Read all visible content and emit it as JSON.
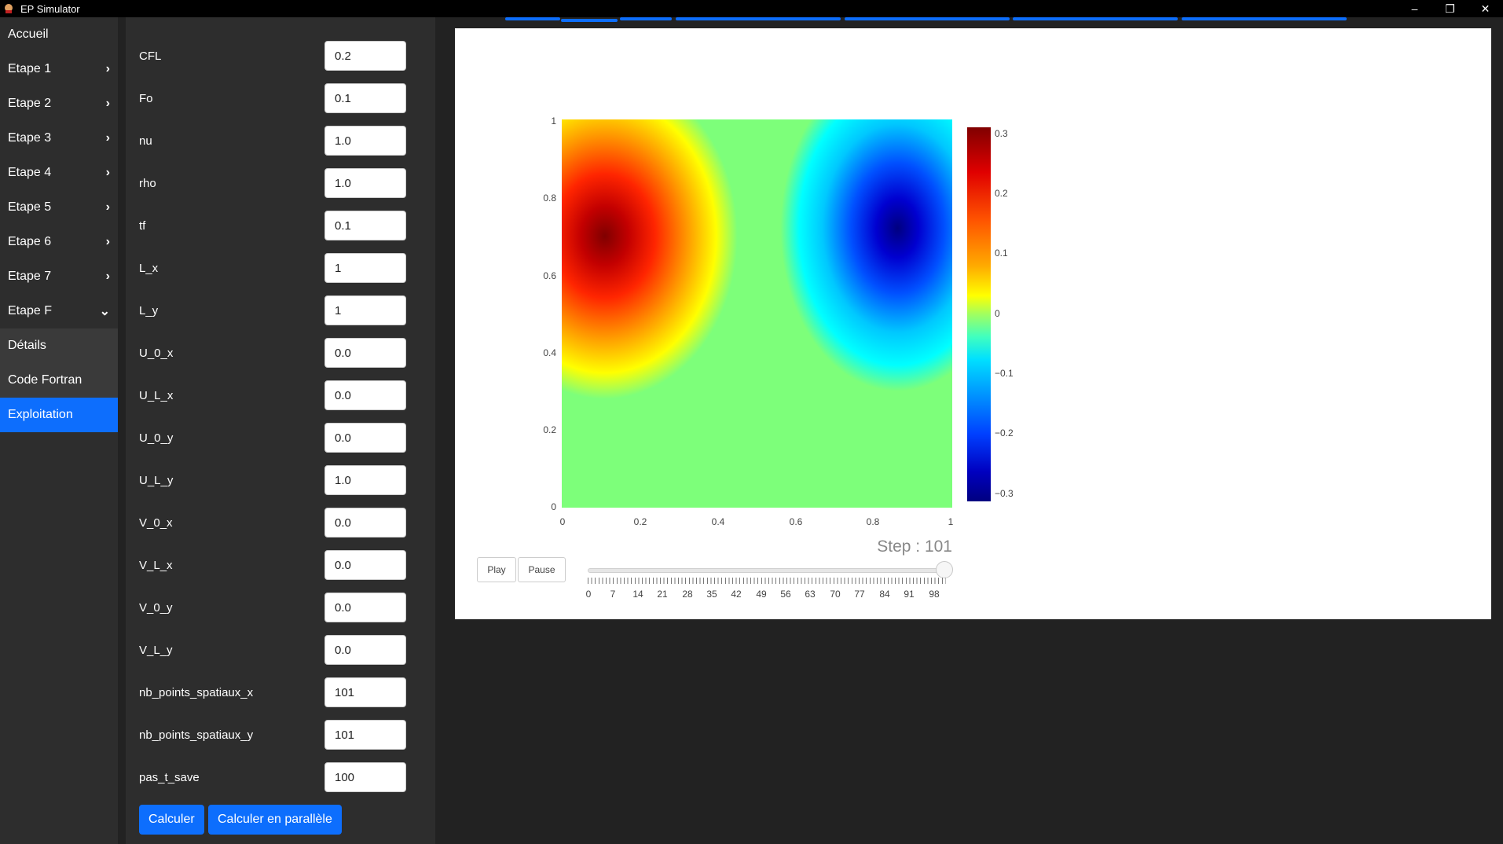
{
  "window": {
    "title": "EP Simulator",
    "minimize": "–",
    "restore": "❐",
    "close": "✕"
  },
  "sidebar": {
    "items": [
      {
        "label": "Accueil",
        "chevron": ""
      },
      {
        "label": "Etape 1",
        "chevron": "›"
      },
      {
        "label": "Etape 2",
        "chevron": "›"
      },
      {
        "label": "Etape 3",
        "chevron": "›"
      },
      {
        "label": "Etape 4",
        "chevron": "›"
      },
      {
        "label": "Etape 5",
        "chevron": "›"
      },
      {
        "label": "Etape 6",
        "chevron": "›"
      },
      {
        "label": "Etape 7",
        "chevron": "›"
      },
      {
        "label": "Etape F",
        "chevron": "⌄"
      },
      {
        "label": "Détails",
        "chevron": ""
      },
      {
        "label": "Code Fortran",
        "chevron": ""
      },
      {
        "label": "Exploitation",
        "chevron": ""
      }
    ]
  },
  "params": [
    {
      "label": "CFL",
      "value": "0.2"
    },
    {
      "label": "Fo",
      "value": "0.1"
    },
    {
      "label": "nu",
      "value": "1.0"
    },
    {
      "label": "rho",
      "value": "1.0"
    },
    {
      "label": "tf",
      "value": "0.1"
    },
    {
      "label": "L_x",
      "value": "1"
    },
    {
      "label": "L_y",
      "value": "1"
    },
    {
      "label": "U_0_x",
      "value": "0.0"
    },
    {
      "label": "U_L_x",
      "value": "0.0"
    },
    {
      "label": "U_0_y",
      "value": "0.0"
    },
    {
      "label": "U_L_y",
      "value": "1.0"
    },
    {
      "label": "V_0_x",
      "value": "0.0"
    },
    {
      "label": "V_L_x",
      "value": "0.0"
    },
    {
      "label": "V_0_y",
      "value": "0.0"
    },
    {
      "label": "V_L_y",
      "value": "0.0"
    },
    {
      "label": "nb_points_spatiaux_x",
      "value": "101"
    },
    {
      "label": "nb_points_spatiaux_y",
      "value": "101"
    },
    {
      "label": "pas_t_save",
      "value": "100"
    }
  ],
  "buttons": {
    "calculer": "Calculer",
    "calculer_parallele": "Calculer en parallèle"
  },
  "chart_data": {
    "type": "heatmap",
    "colorscale": "jet",
    "x_ticks": [
      "0",
      "0.2",
      "0.4",
      "0.6",
      "0.8",
      "1"
    ],
    "y_ticks": [
      "0",
      "0.2",
      "0.4",
      "0.6",
      "0.8",
      "1"
    ],
    "xlim": [
      0,
      1
    ],
    "ylim": [
      0,
      1
    ],
    "zlim": [
      -0.32,
      0.32
    ],
    "colorbar_ticks": [
      "0.3",
      "0.2",
      "0.1",
      "0",
      "−0.1",
      "−0.2",
      "−0.3"
    ],
    "features": [
      {
        "x": 0.12,
        "y": 0.75,
        "z": 0.32
      },
      {
        "x": 0.86,
        "y": 0.76,
        "z": -0.32
      }
    ]
  },
  "animation": {
    "step_label": "Step : 101",
    "play": "Play",
    "pause": "Pause",
    "slider_labels": [
      "0",
      "7",
      "14",
      "21",
      "28",
      "35",
      "42",
      "49",
      "56",
      "63",
      "70",
      "77",
      "84",
      "91",
      "98"
    ],
    "slider_fraction": 1.0
  }
}
